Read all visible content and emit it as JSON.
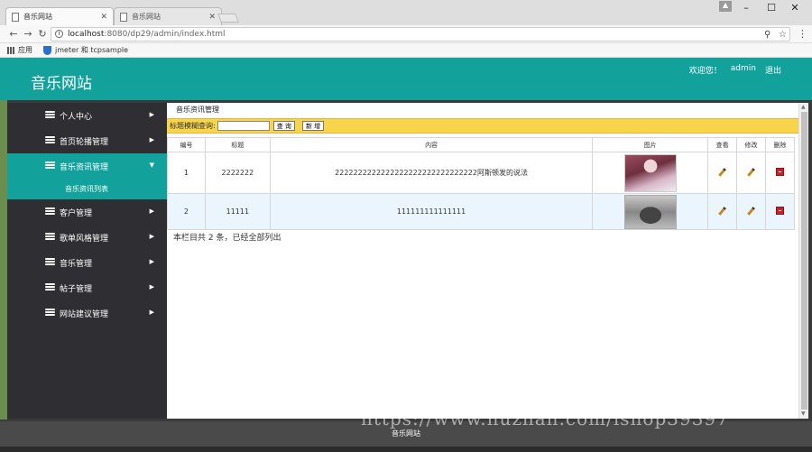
{
  "browser": {
    "tabs": [
      {
        "title": "音乐网站"
      },
      {
        "title": "音乐网站"
      }
    ],
    "url_host": "localhost",
    "url_path": ":8080/dp29/admin/index.html",
    "bookmarks": [
      "应用",
      "jmeter 和 tcpsample"
    ]
  },
  "header": {
    "site_title": "音乐网站",
    "welcome": "欢迎您！",
    "username": "admin",
    "logout": "退出"
  },
  "sidebar": {
    "items": [
      {
        "label": "个人中心"
      },
      {
        "label": "首页轮播管理"
      },
      {
        "label": "音乐资讯管理"
      },
      {
        "label": "客户管理"
      },
      {
        "label": "歌单风格管理"
      },
      {
        "label": "音乐管理"
      },
      {
        "label": "帖子管理"
      },
      {
        "label": "网站建议管理"
      }
    ],
    "sub_item": "音乐资讯列表"
  },
  "main": {
    "panel_title": "音乐资讯管理",
    "search_label": "标题模糊查询:",
    "search_value": "",
    "search_button": "查 询",
    "add_button": "新 增",
    "columns": [
      "编号",
      "标题",
      "内容",
      "图片",
      "查看",
      "修改",
      "删除"
    ],
    "rows": [
      {
        "id": "1",
        "title": "2222222",
        "content": "2222222222222222222222222222222阿斯顿发的说法",
        "image": "anime-girl-thumbnail"
      },
      {
        "id": "2",
        "title": "11111",
        "content": "111111111111111",
        "image": "robot-car-thumbnail"
      }
    ],
    "summary": "本栏目共 2 条，已经全部列出"
  },
  "footer": {
    "text": "音乐网站"
  },
  "watermark": "https://www.huzhan.com/ishop39397",
  "colors": {
    "brand": "#12a19b",
    "sidebar": "#2f2f33",
    "search_bar": "#f8d44a",
    "delete": "#c3242a"
  }
}
